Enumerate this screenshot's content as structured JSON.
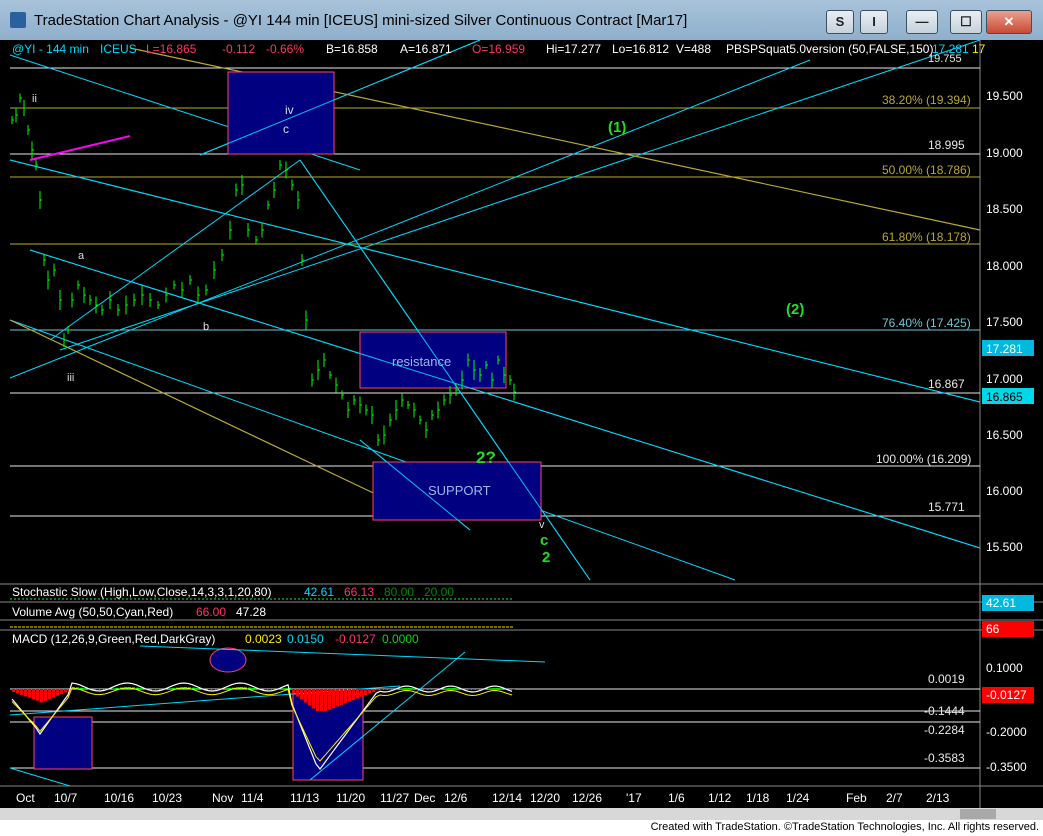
{
  "window": {
    "title": "TradeStation Chart Analysis - @YI 144 min [ICEUS] mini-sized Silver Continuous Contract [Mar17]",
    "btn_s": "S",
    "btn_i": "I",
    "btn_min": "—",
    "btn_max": "☐",
    "btn_close": "✕"
  },
  "header": {
    "symbol": "@YI - 144 min",
    "exchange": "ICEUS",
    "last": "L=16.865",
    "change": "-0.112",
    "pct": "-0.66%",
    "bid": "B=16.858",
    "ask": "A=16.871",
    "open": "O=16.959",
    "high": "Hi=17.277",
    "low": "Lo=16.812",
    "volume": "V=488",
    "study": "PBSPSquat5.0version (50,FALSE,150)",
    "v1": "17.281",
    "v2": "17"
  },
  "colors": {
    "up": "#00ff00",
    "down": "#ff0000",
    "cyan": "#00d8ff",
    "fib_line": "#b8a832",
    "zone": "#000080"
  },
  "price_axis": {
    "ticks": [
      "19.500",
      "19.000",
      "18.500",
      "18.000",
      "17.500",
      "17.000",
      "16.500",
      "16.000",
      "15.500"
    ],
    "last_cyan": "17.281",
    "last_price": "16.865",
    "top_cut": "19.755"
  },
  "levels": {
    "fib382": "38.20% (19.394)",
    "lvl18995": "18.995",
    "fib50": "50.00% (18.786)",
    "fib618": "61.80% (18.178)",
    "fib764": "76.40% (17.425)",
    "lvl16867": "16.867",
    "fib100": "100.00% (16.209)",
    "lvl15771": "15.771"
  },
  "labels": {
    "w1": "(1)",
    "w2": "(2)",
    "ii": "ii",
    "iii": "iii",
    "iv": "iv",
    "c_top": "c",
    "a": "a",
    "b": "b",
    "resistance": "resistance",
    "support": "SUPPORT",
    "two_q": "2?",
    "v": "v",
    "c_green": "c",
    "two": "2"
  },
  "stochastic": {
    "name": "Stochastic Slow (High,Low,Close,14,3,3,1,20,80)",
    "k": "42.61",
    "d": "66.13",
    "ob": "80.00",
    "os": "20.00",
    "axis": "42.61"
  },
  "volume": {
    "name": "Volume Avg (50,50,Cyan,Red)",
    "v1": "66.00",
    "v2": "47.28",
    "axis": "66"
  },
  "macd": {
    "name": "MACD (12,26,9,Green,Red,DarkGray)",
    "v1": "0.0023",
    "v2": "0.0150",
    "v3": "-0.0127",
    "v4": "0.0000",
    "ticks": [
      "0.1000",
      "-0.2000",
      "-0.3500"
    ],
    "lvl0019": "0.0019",
    "lvl1444": "-0.1444",
    "lvl2284": "-0.2284",
    "lvl3583": "-0.3583",
    "axis_neg": "-0.0127"
  },
  "date_axis": [
    "Oct",
    "10/7",
    "10/16",
    "10/23",
    "Nov",
    "11/4",
    "11/13",
    "11/20",
    "11/27",
    "Dec",
    "12/6",
    "12/14",
    "12/20",
    "12/26",
    "'17",
    "1/6",
    "1/12",
    "1/18",
    "1/24",
    "Feb",
    "2/7",
    "2/13"
  ],
  "footer": "Created with TradeStation. ©TradeStation Technologies, Inc. All rights reserved."
}
